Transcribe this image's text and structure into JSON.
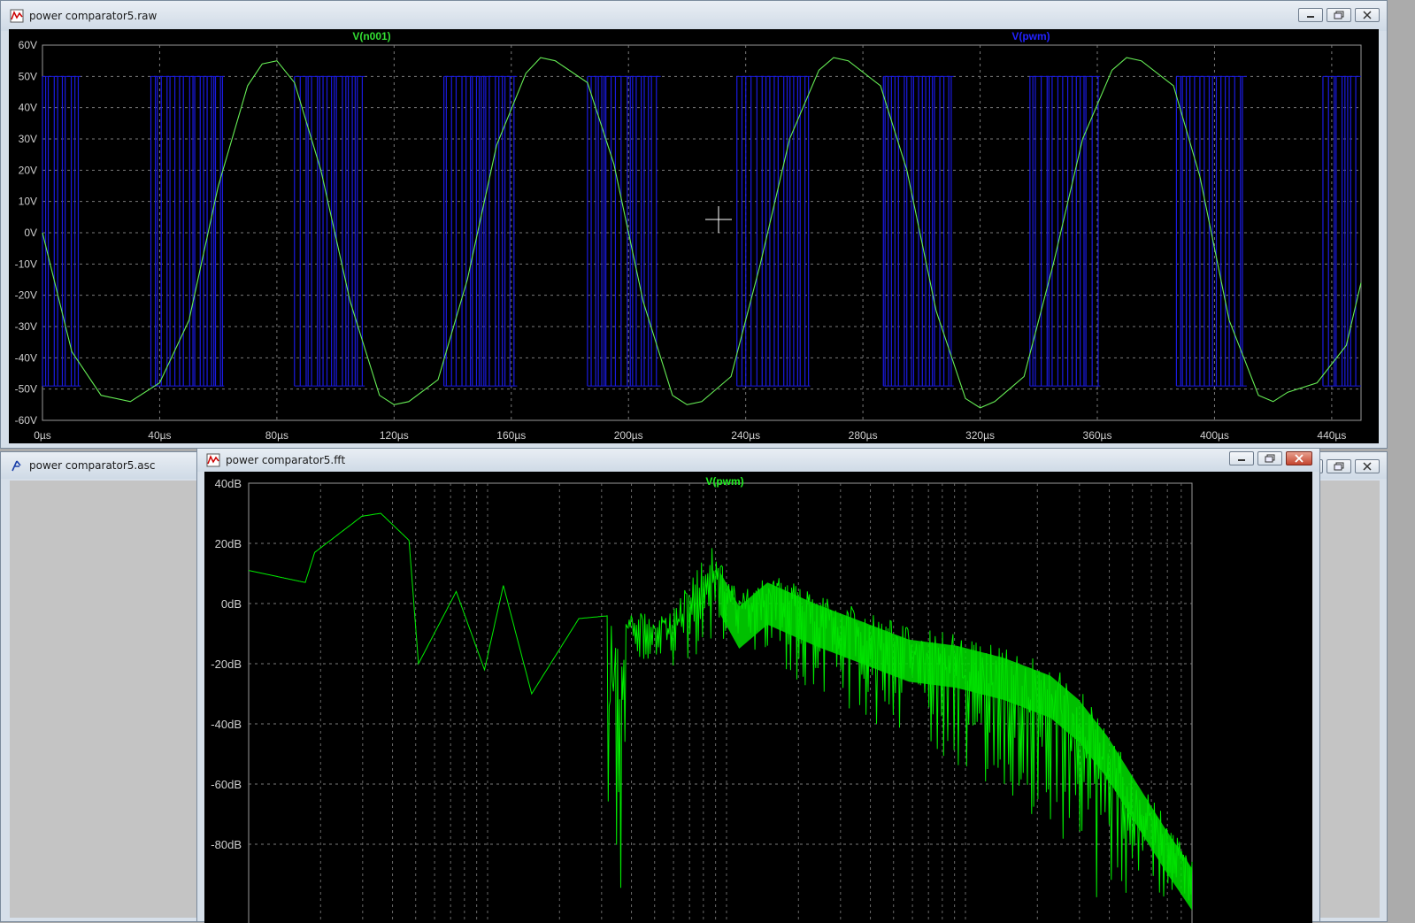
{
  "raw_window": {
    "title": "power comparator5.raw",
    "trace_labels": [
      "V(n001)",
      "V(pwm)"
    ],
    "trace_colors": {
      "V(n001)": "#33dd33",
      "V(pwm)": "#1a1aff"
    }
  },
  "asc_window": {
    "title": "power comparator5.asc"
  },
  "fft_window": {
    "title": "power comparator5.fft",
    "trace_label": "V(pwm)",
    "trace_color": "#00ff00"
  },
  "chart_data": [
    {
      "type": "line",
      "xlabel": "",
      "ylabel": "",
      "x_ticks": [
        "0µs",
        "40µs",
        "80µs",
        "120µs",
        "160µs",
        "200µs",
        "240µs",
        "280µs",
        "320µs",
        "360µs",
        "400µs",
        "440µs"
      ],
      "y_ticks": [
        "60V",
        "50V",
        "40V",
        "30V",
        "20V",
        "10V",
        "0V",
        "-10V",
        "-20V",
        "-30V",
        "-40V",
        "-50V",
        "-60V"
      ],
      "xlim": [
        0,
        450
      ],
      "ylim": [
        -60,
        60
      ],
      "grid": true,
      "series": [
        {
          "name": "V(n001)",
          "x": [
            0,
            10,
            20,
            30,
            40,
            50,
            60,
            70,
            75,
            80,
            86,
            95,
            105,
            115,
            120,
            125,
            135,
            145,
            155,
            165,
            170,
            175,
            186,
            195,
            205,
            215,
            220,
            225,
            235,
            245,
            255,
            265,
            270,
            275,
            286,
            295,
            305,
            315,
            320,
            325,
            335,
            345,
            355,
            365,
            370,
            375,
            386,
            395,
            405,
            415,
            420,
            425,
            435,
            445,
            450
          ],
          "y": [
            0,
            -38,
            -52,
            -54,
            -48,
            -28,
            15,
            47,
            54,
            55,
            48,
            20,
            -22,
            -52,
            -55,
            -54,
            -47,
            -15,
            28,
            51,
            56,
            55,
            48,
            22,
            -22,
            -52,
            -55,
            -54,
            -46,
            -10,
            30,
            52,
            56,
            55,
            47,
            20,
            -25,
            -53,
            -56,
            -54,
            -46,
            -10,
            30,
            52,
            56,
            55,
            47,
            18,
            -28,
            -52,
            -54,
            -51,
            -48,
            -36,
            -16
          ]
        },
        {
          "name": "V(pwm)",
          "type": "pwm_bursts",
          "high": 50,
          "low": -49,
          "bursts_us": [
            [
              0,
              13
            ],
            [
              37,
              62
            ],
            [
              86,
              110
            ],
            [
              137,
              162
            ],
            [
              186,
              211
            ],
            [
              237,
              262
            ],
            [
              287,
              311
            ],
            [
              337,
              361
            ],
            [
              387,
              411
            ],
            [
              437,
              450
            ]
          ]
        }
      ]
    },
    {
      "type": "line",
      "xlabel": "",
      "ylabel": "",
      "y_ticks": [
        "40dB",
        "20dB",
        "0dB",
        "-20dB",
        "-40dB",
        "-60dB",
        "-80dB"
      ],
      "ylim": [
        -99,
        40
      ],
      "x_scale": "log",
      "grid": true,
      "series": [
        {
          "name": "V(pwm)",
          "envelope_top": [
            [
              0,
              11
            ],
            [
              0.06,
              7
            ],
            [
              0.07,
              17
            ],
            [
              0.12,
              29
            ],
            [
              0.14,
              30
            ],
            [
              0.17,
              21
            ],
            [
              0.18,
              -20
            ],
            [
              0.22,
              4
            ],
            [
              0.25,
              -22
            ],
            [
              0.27,
              6
            ],
            [
              0.3,
              -30
            ],
            [
              0.35,
              -5
            ],
            [
              0.45,
              -2
            ],
            [
              0.49,
              20
            ],
            [
              0.52,
              3
            ],
            [
              0.55,
              11
            ],
            [
              0.6,
              4
            ],
            [
              0.65,
              -2
            ],
            [
              0.7,
              -8
            ],
            [
              0.75,
              -10
            ],
            [
              0.8,
              -14
            ],
            [
              0.85,
              -20
            ],
            [
              0.88,
              -28
            ],
            [
              0.91,
              -40
            ],
            [
              0.94,
              -55
            ],
            [
              0.97,
              -70
            ],
            [
              1,
              -84
            ]
          ],
          "envelope_bottom": [
            [
              0.4,
              -20
            ],
            [
              0.45,
              -22
            ],
            [
              0.5,
              -12
            ],
            [
              0.55,
              -20
            ],
            [
              0.6,
              -30
            ],
            [
              0.65,
              -38
            ],
            [
              0.7,
              -45
            ],
            [
              0.75,
              -55
            ],
            [
              0.8,
              -65
            ],
            [
              0.85,
              -75
            ],
            [
              0.88,
              -85
            ],
            [
              0.9,
              -99
            ],
            [
              1,
              -99
            ]
          ]
        }
      ]
    }
  ]
}
